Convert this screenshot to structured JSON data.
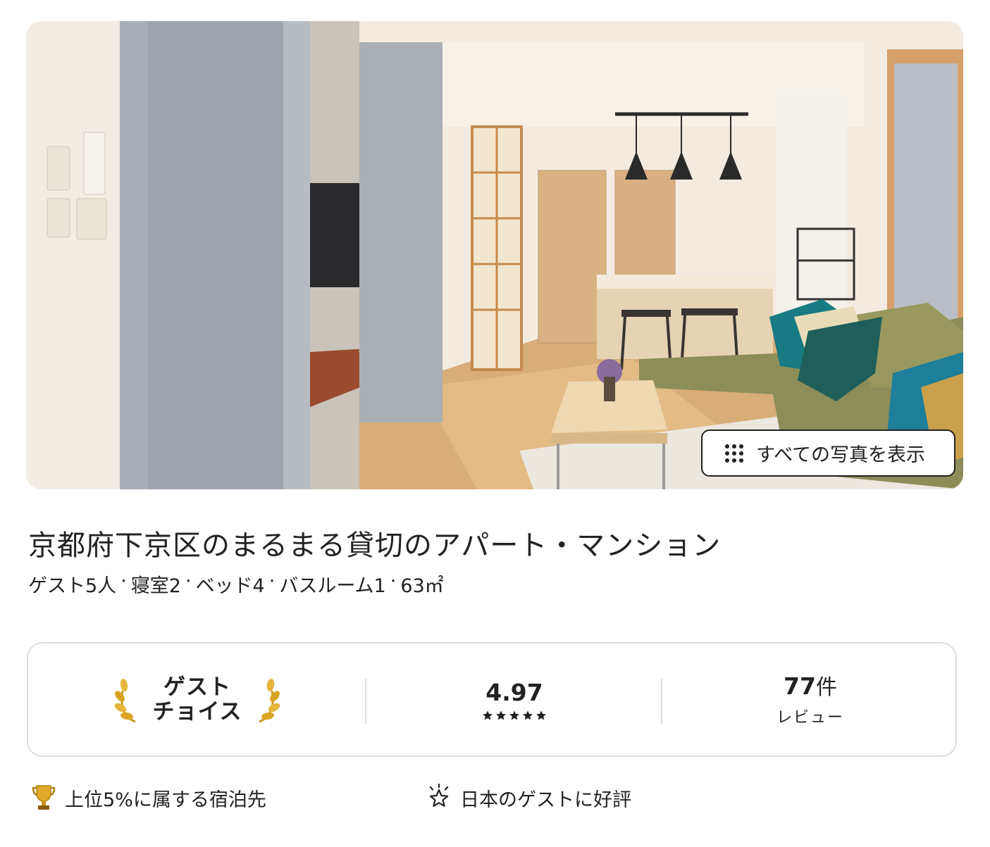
{
  "hero": {
    "show_all_label": "すべての写真を表示",
    "show_all_icon": "grid-dots-icon"
  },
  "listing": {
    "title": "京都府下京区のまるまる貸切のアパート・マンション",
    "specs": [
      "ゲスト5人",
      "寝室2",
      "ベッド4",
      "バスルーム1",
      "63㎡"
    ],
    "specs_separator": "·"
  },
  "guest_favorite": {
    "badge_line1": "ゲスト",
    "badge_line2": "チョイス",
    "badge_icon": "laurel-icon",
    "rating": "4.97",
    "stars": 5,
    "reviews_count": "77",
    "reviews_unit": "件",
    "reviews_label": "レビュー"
  },
  "highlights": [
    {
      "icon": "trophy-icon",
      "text": "上位5%に属する宿泊先"
    },
    {
      "icon": "sparkle-star-icon",
      "text": "日本のゲストに好評"
    }
  ],
  "colors": {
    "text": "#222222",
    "border": "#dddddd",
    "laurel_gold": "#d9a521"
  }
}
